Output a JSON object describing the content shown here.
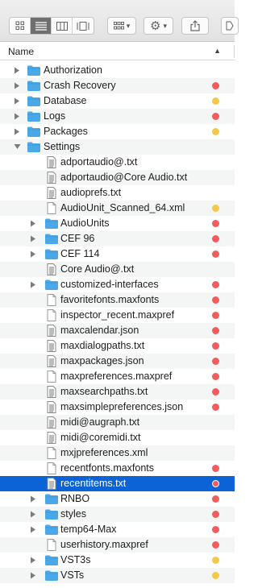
{
  "header": {
    "name_label": "Name"
  },
  "colors": {
    "red": "#f15c5e",
    "yellow": "#f3c94a",
    "selection": "#0b63d6",
    "folder": "#4aa8e8"
  },
  "toolbar": {
    "view_buttons": [
      "icon-view-icon",
      "list-view-icon",
      "column-view-icon",
      "gallery-view-icon"
    ],
    "group_icon": "group-grid-icon",
    "action_icon": "gear-icon",
    "share_icon": "share-icon"
  },
  "rows": [
    {
      "name": "Authorization",
      "type": "folder",
      "level": 0,
      "expanded": false,
      "tag": "none"
    },
    {
      "name": "Crash Recovery",
      "type": "folder",
      "level": 0,
      "expanded": false,
      "tag": "red"
    },
    {
      "name": "Database",
      "type": "folder",
      "level": 0,
      "expanded": false,
      "tag": "yellow"
    },
    {
      "name": "Logs",
      "type": "folder",
      "level": 0,
      "expanded": false,
      "tag": "red"
    },
    {
      "name": "Packages",
      "type": "folder",
      "level": 0,
      "expanded": false,
      "tag": "yellow"
    },
    {
      "name": "Settings",
      "type": "folder",
      "level": 0,
      "expanded": true,
      "tag": "none"
    },
    {
      "name": "adportaudio@.txt",
      "type": "text",
      "level": 1,
      "tag": "none"
    },
    {
      "name": "adportaudio@Core Audio.txt",
      "type": "text",
      "level": 1,
      "tag": "none"
    },
    {
      "name": "audioprefs.txt",
      "type": "text",
      "level": 1,
      "tag": "none"
    },
    {
      "name": "AudioUnit_Scanned_64.xml",
      "type": "doc",
      "level": 1,
      "tag": "yellow"
    },
    {
      "name": "AudioUnits",
      "type": "folder",
      "level": 1,
      "expanded": false,
      "tag": "red"
    },
    {
      "name": "CEF 96",
      "type": "folder",
      "level": 1,
      "expanded": false,
      "tag": "red"
    },
    {
      "name": "CEF 114",
      "type": "folder",
      "level": 1,
      "expanded": false,
      "tag": "red"
    },
    {
      "name": "Core Audio@.txt",
      "type": "text",
      "level": 1,
      "tag": "none"
    },
    {
      "name": "customized-interfaces",
      "type": "folder",
      "level": 1,
      "expanded": false,
      "tag": "red"
    },
    {
      "name": "favoritefonts.maxfonts",
      "type": "doc",
      "level": 1,
      "tag": "red"
    },
    {
      "name": "inspector_recent.maxpref",
      "type": "doc",
      "level": 1,
      "tag": "red"
    },
    {
      "name": "maxcalendar.json",
      "type": "text",
      "level": 1,
      "tag": "red"
    },
    {
      "name": "maxdialogpaths.txt",
      "type": "text",
      "level": 1,
      "tag": "red"
    },
    {
      "name": "maxpackages.json",
      "type": "text",
      "level": 1,
      "tag": "red"
    },
    {
      "name": "maxpreferences.maxpref",
      "type": "doc",
      "level": 1,
      "tag": "red"
    },
    {
      "name": "maxsearchpaths.txt",
      "type": "text",
      "level": 1,
      "tag": "red"
    },
    {
      "name": "maxsimplepreferences.json",
      "type": "text",
      "level": 1,
      "tag": "red"
    },
    {
      "name": "midi@augraph.txt",
      "type": "text",
      "level": 1,
      "tag": "none"
    },
    {
      "name": "midi@coremidi.txt",
      "type": "text",
      "level": 1,
      "tag": "none"
    },
    {
      "name": "mxjpreferences.xml",
      "type": "doc",
      "level": 1,
      "tag": "none"
    },
    {
      "name": "recentfonts.maxfonts",
      "type": "doc",
      "level": 1,
      "tag": "red"
    },
    {
      "name": "recentitems.txt",
      "type": "text",
      "level": 1,
      "tag": "red",
      "selected": true
    },
    {
      "name": "RNBO",
      "type": "folder",
      "level": 1,
      "expanded": false,
      "tag": "red"
    },
    {
      "name": "styles",
      "type": "folder",
      "level": 1,
      "expanded": false,
      "tag": "red"
    },
    {
      "name": "temp64-Max",
      "type": "folder",
      "level": 1,
      "expanded": false,
      "tag": "red"
    },
    {
      "name": "userhistory.maxpref",
      "type": "doc",
      "level": 1,
      "tag": "red"
    },
    {
      "name": "VST3s",
      "type": "folder",
      "level": 1,
      "expanded": false,
      "tag": "yellow"
    },
    {
      "name": "VSTs",
      "type": "folder",
      "level": 1,
      "expanded": false,
      "tag": "yellow"
    }
  ]
}
